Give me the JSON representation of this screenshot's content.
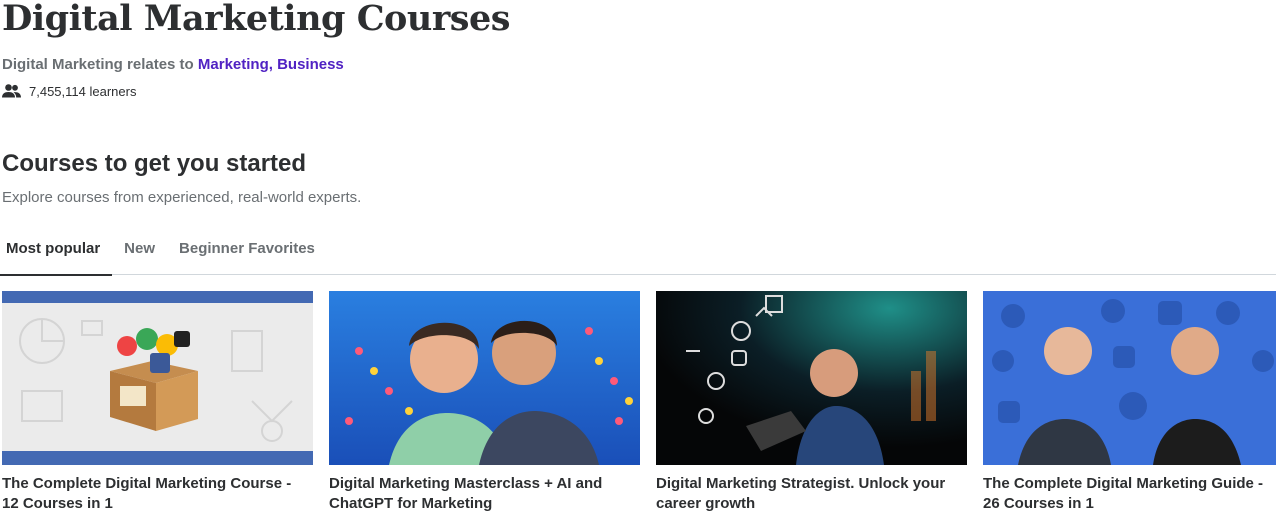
{
  "header": {
    "title": "Digital Marketing Courses",
    "relates_prefix": "Digital Marketing relates to ",
    "relates_links": "Marketing, Business",
    "learners": "7,455,114 learners",
    "learners_icon": "people-icon"
  },
  "section": {
    "title": "Courses to get you started",
    "subtitle": "Explore courses from experienced, real-world experts."
  },
  "tabs": [
    {
      "label": "Most popular",
      "active": true
    },
    {
      "label": "New",
      "active": false
    },
    {
      "label": "Beginner Favorites",
      "active": false
    }
  ],
  "courses": [
    {
      "line1": "The Complete Digital Marketing Course -",
      "line2": "12 Courses in 1"
    },
    {
      "line1": "Digital Marketing Masterclass + AI and",
      "line2": "ChatGPT for Marketing"
    },
    {
      "line1": "Digital Marketing Strategist. Unlock your",
      "line2": "career growth"
    },
    {
      "line1": "The Complete Digital Marketing Guide -",
      "line2": "26 Courses in 1"
    }
  ],
  "colors": {
    "text": "#2d2f31",
    "muted": "#6a6f73",
    "link": "#5022c3",
    "divider": "#d1d7dc"
  }
}
